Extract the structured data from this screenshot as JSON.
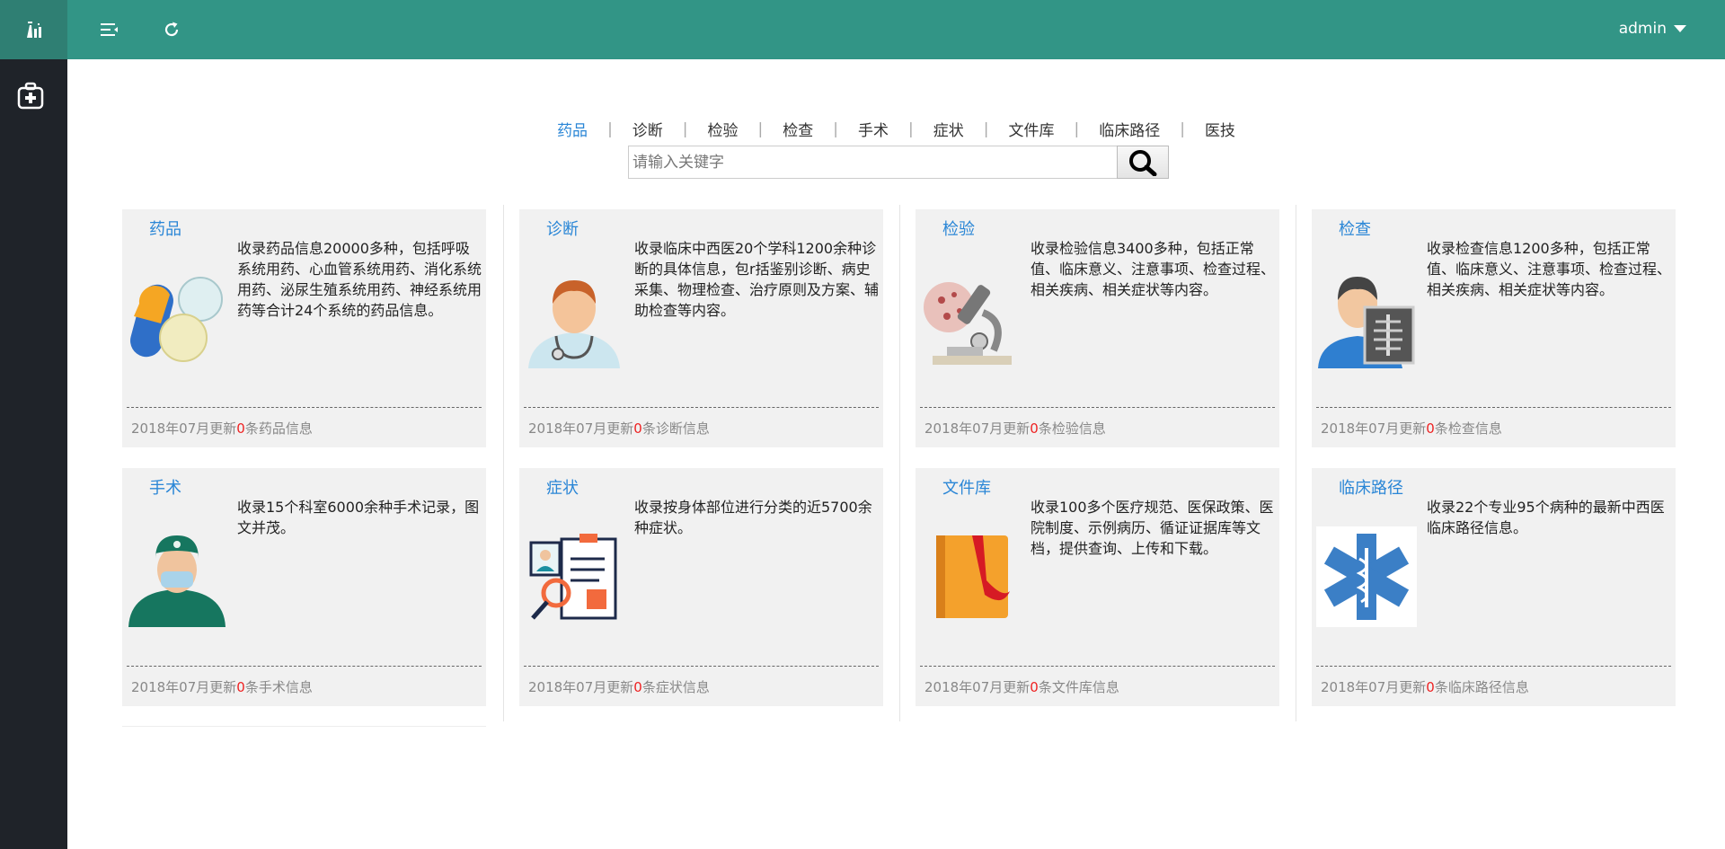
{
  "sidebar": {
    "logo_icon": "flask-logo-icon",
    "nav_icon": "medical-kit-icon"
  },
  "topbar": {
    "menu_icon": "menu-toggle-icon",
    "refresh_icon": "refresh-icon",
    "user": "admin"
  },
  "categories": [
    "药品",
    "诊断",
    "检验",
    "检查",
    "手术",
    "症状",
    "文件库",
    "临床路径",
    "医技"
  ],
  "search": {
    "placeholder": "请输入关键字",
    "value": ""
  },
  "cards": [
    {
      "title": "药品",
      "desc": "收录药品信息20000多种，包括呼吸系统用药、心血管系统用药、消化系统用药、泌尿生殖系统用药、神经系统用药等合计24个系统的药品信息。",
      "foot_prefix": "2018年07月更新",
      "count": "0",
      "foot_suffix": "条药品信息",
      "icon": "pills-icon"
    },
    {
      "title": "诊断",
      "desc": "收录临床中西医20个学科1200余种诊断的具体信息，包r括鉴别诊断、病史采集、物理检查、治疗原则及方案、辅助检查等内容。",
      "foot_prefix": "2018年07月更新",
      "count": "0",
      "foot_suffix": "条诊断信息",
      "icon": "doctor-icon"
    },
    {
      "title": "检验",
      "desc": "收录检验信息3400多种，包括正常值、临床意义、注意事项、检查过程、相关疾病、相关症状等内容。",
      "foot_prefix": "2018年07月更新",
      "count": "0",
      "foot_suffix": "条检验信息",
      "icon": "microscope-icon"
    },
    {
      "title": "检查",
      "desc": "收录检查信息1200多种，包括正常值、临床意义、注意事项、检查过程、相关疾病、相关症状等内容。",
      "foot_prefix": "2018年07月更新",
      "count": "0",
      "foot_suffix": "条检查信息",
      "icon": "xray-icon"
    },
    {
      "title": "手术",
      "desc": "收录15个科室6000余种手术记录，图文并茂。",
      "foot_prefix": "2018年07月更新",
      "count": "0",
      "foot_suffix": "条手术信息",
      "icon": "surgeon-icon"
    },
    {
      "title": "症状",
      "desc": "收录按身体部位进行分类的近5700余种症状。",
      "foot_prefix": "2018年07月更新",
      "count": "0",
      "foot_suffix": "条症状信息",
      "icon": "clipboard-search-icon"
    },
    {
      "title": "文件库",
      "desc": "收录100多个医疗规范、医保政策、医院制度、示例病历、循证证据库等文档，提供查询、上传和下载。",
      "foot_prefix": "2018年07月更新",
      "count": "0",
      "foot_suffix": "条文件库信息",
      "icon": "book-icon"
    },
    {
      "title": "临床路径",
      "desc": "收录22个专业95个病种的最新中西医临床路径信息。",
      "foot_prefix": "2018年07月更新",
      "count": "0",
      "foot_suffix": "条临床路径信息",
      "icon": "star-of-life-icon"
    }
  ]
}
